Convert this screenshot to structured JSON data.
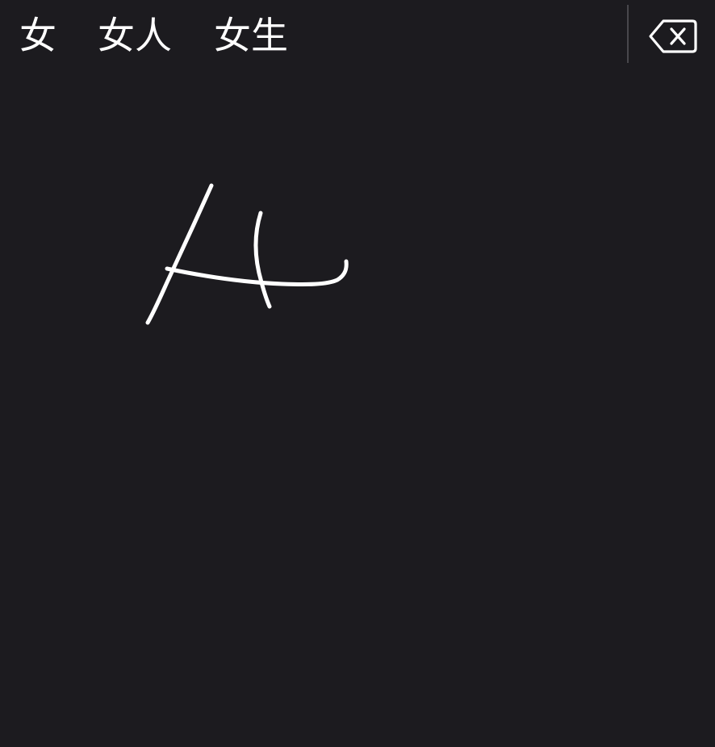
{
  "candidates": [
    {
      "label": "女"
    },
    {
      "label": "女人"
    },
    {
      "label": "女生"
    }
  ],
  "delete_button": {
    "icon": "backspace-icon"
  },
  "colors": {
    "background": "#1c1b1f",
    "ink": "#ffffff",
    "divider": "#48474c"
  }
}
